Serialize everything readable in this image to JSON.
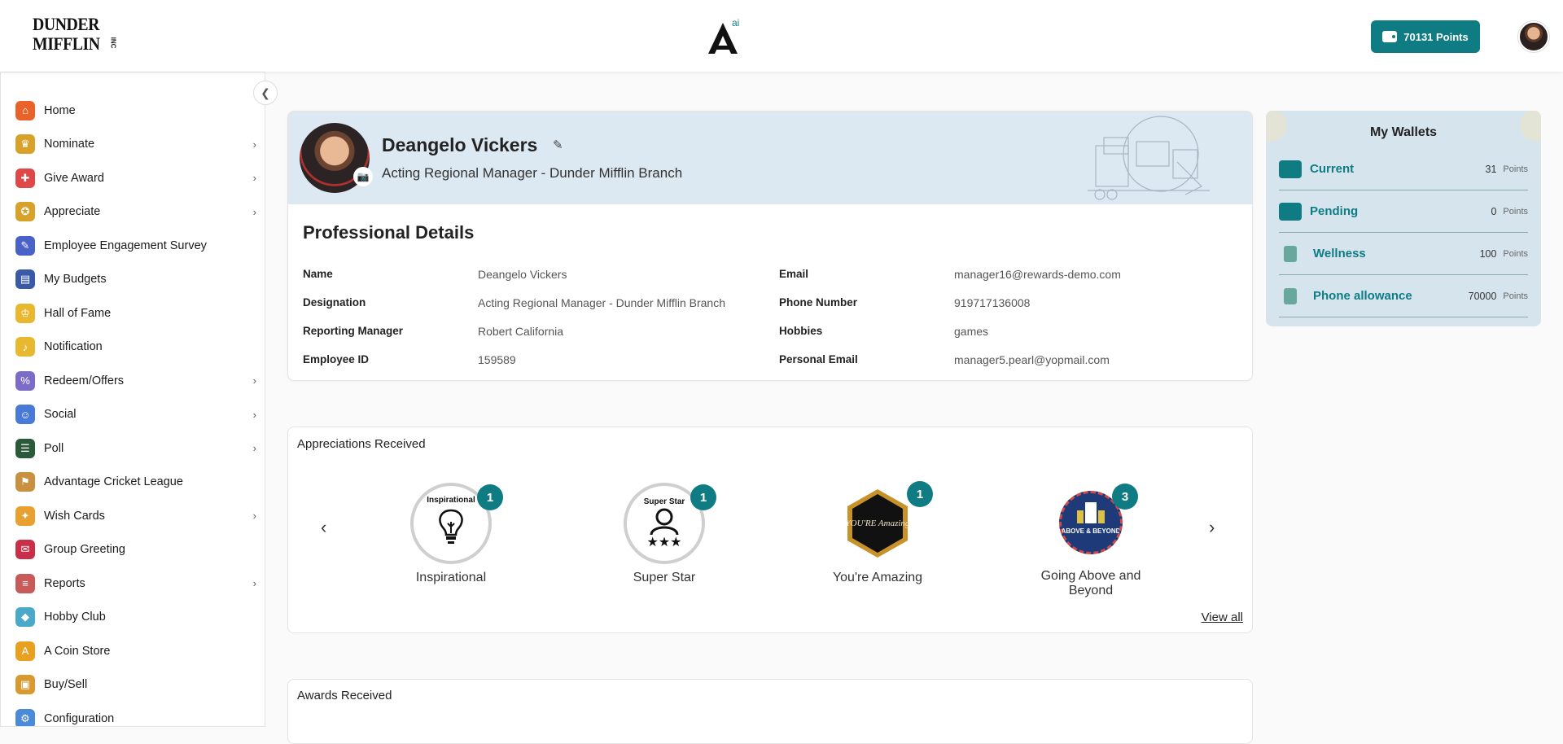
{
  "header": {
    "brand_line1": "DUNDER",
    "brand_line2": "MIFFLIN",
    "brand_suffix": "INC",
    "center_logo_sup": "ai",
    "points_label": "70131  Points"
  },
  "sidebar": {
    "items": [
      {
        "label": "Home",
        "icon": "home-icon",
        "color": "#e8622a",
        "chevron": false
      },
      {
        "label": "Nominate",
        "icon": "trophy-icon",
        "color": "#d8a12a",
        "chevron": true
      },
      {
        "label": "Give Award",
        "icon": "gift-icon",
        "color": "#e04848",
        "chevron": true
      },
      {
        "label": "Appreciate",
        "icon": "medal-icon",
        "color": "#d8a12a",
        "chevron": true
      },
      {
        "label": "Employee Engagement Survey",
        "icon": "survey-icon",
        "color": "#4a62c8",
        "chevron": false
      },
      {
        "label": "My Budgets",
        "icon": "budget-icon",
        "color": "#3a5aa8",
        "chevron": false
      },
      {
        "label": "Hall of Fame",
        "icon": "crown-icon",
        "color": "#e8b830",
        "chevron": false
      },
      {
        "label": "Notification",
        "icon": "bell-icon",
        "color": "#e8b830",
        "chevron": false
      },
      {
        "label": "Redeem/Offers",
        "icon": "offer-icon",
        "color": "#7c6cc8",
        "chevron": true
      },
      {
        "label": "Social",
        "icon": "social-icon",
        "color": "#4a7ad8",
        "chevron": true
      },
      {
        "label": "Poll",
        "icon": "poll-icon",
        "color": "#2a5a3a",
        "chevron": true
      },
      {
        "label": "Advantage Cricket League",
        "icon": "cricket-icon",
        "color": "#c89040",
        "chevron": false
      },
      {
        "label": "Wish Cards",
        "icon": "party-icon",
        "color": "#e8a030",
        "chevron": true
      },
      {
        "label": "Group Greeting",
        "icon": "greeting-icon",
        "color": "#c8304a",
        "chevron": false
      },
      {
        "label": "Reports",
        "icon": "report-icon",
        "color": "#c85a5a",
        "chevron": true
      },
      {
        "label": "Hobby Club",
        "icon": "hobby-icon",
        "color": "#4aa8c8",
        "chevron": false
      },
      {
        "label": "A Coin Store",
        "icon": "coin-icon",
        "color": "#e8a020",
        "chevron": false
      },
      {
        "label": "Buy/Sell",
        "icon": "bag-icon",
        "color": "#d89a30",
        "chevron": false
      },
      {
        "label": "Configuration",
        "icon": "config-icon",
        "color": "#4a8ad8",
        "chevron": false
      }
    ]
  },
  "profile": {
    "name": "Deangelo Vickers",
    "title": "Acting Regional Manager - Dunder Mifflin Branch",
    "section_title": "Professional Details",
    "details_left": [
      {
        "key": "Name",
        "value": "Deangelo Vickers"
      },
      {
        "key": "Designation",
        "value": "Acting Regional Manager - Dunder Mifflin Branch"
      },
      {
        "key": "Reporting Manager",
        "value": "Robert California"
      },
      {
        "key": "Employee ID",
        "value": "159589"
      }
    ],
    "details_right": [
      {
        "key": "Email",
        "value": "manager16@rewards-demo.com"
      },
      {
        "key": "Phone Number",
        "value": "919717136008"
      },
      {
        "key": "Hobbies",
        "value": "games"
      },
      {
        "key": "Personal Email",
        "value": "manager5.pearl@yopmail.com"
      }
    ]
  },
  "wallets": {
    "title": "My Wallets",
    "items": [
      {
        "name": "Current",
        "amount": "31",
        "unit": "Points"
      },
      {
        "name": "Pending",
        "amount": "0",
        "unit": "Points"
      },
      {
        "name": "Wellness",
        "amount": "100",
        "unit": "Points"
      },
      {
        "name": "Phone allowance",
        "amount": "70000",
        "unit": "Points"
      }
    ]
  },
  "appreciations": {
    "title": "Appreciations Received",
    "badges": [
      {
        "label": "Inspirational",
        "count": "1",
        "art_text": "Inspirational"
      },
      {
        "label": "Super Star",
        "count": "1",
        "art_text": "Super Star"
      },
      {
        "label": "You're Amazing",
        "count": "1",
        "art_text": "YOU'RE Amazing"
      },
      {
        "label": "Going Above and Beyond",
        "count": "3",
        "art_text": "ABOVE & BEYOND"
      }
    ],
    "view_all": "View all"
  },
  "awards": {
    "title": "Awards Received"
  },
  "colors": {
    "accent": "#0f7c84",
    "wallet_bg": "#d6e4ee",
    "profile_header_bg": "#dce8f2"
  }
}
